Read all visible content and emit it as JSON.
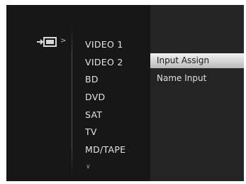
{
  "source_menu": {
    "items": [
      {
        "label": "VIDEO 1"
      },
      {
        "label": "VIDEO 2"
      },
      {
        "label": "BD"
      },
      {
        "label": "DVD"
      },
      {
        "label": "SAT"
      },
      {
        "label": "TV"
      },
      {
        "label": "MD/TAPE"
      }
    ],
    "more_indicator": "∨"
  },
  "submenu": {
    "items": [
      {
        "label": "Input Assign",
        "selected": true
      },
      {
        "label": "Name Input",
        "selected": false
      }
    ]
  },
  "icons": {
    "input": "input-source-icon",
    "chevron": "chevron-right-icon",
    "more": "chevron-down-icon"
  },
  "colors": {
    "background": "#171717",
    "panel": "#242424",
    "highlight": "#d8d8d8",
    "text": "#e4e4e4"
  }
}
